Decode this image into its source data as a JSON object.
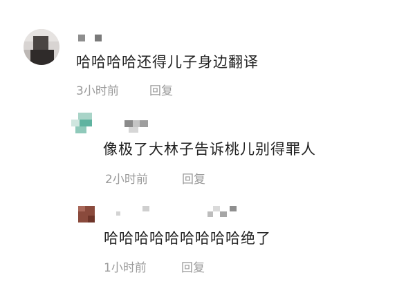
{
  "comments": [
    {
      "text": "哈哈哈哈还得儿子身边翻译",
      "time": "3小时前",
      "reply_label": "回复",
      "replies": [
        {
          "text": "像极了大林子告诉桃儿别得罪人",
          "time": "2小时前",
          "reply_label": "回复"
        },
        {
          "text": "哈哈哈哈哈哈哈哈哈绝了",
          "time": "1小时前",
          "reply_label": "回复"
        }
      ]
    }
  ]
}
